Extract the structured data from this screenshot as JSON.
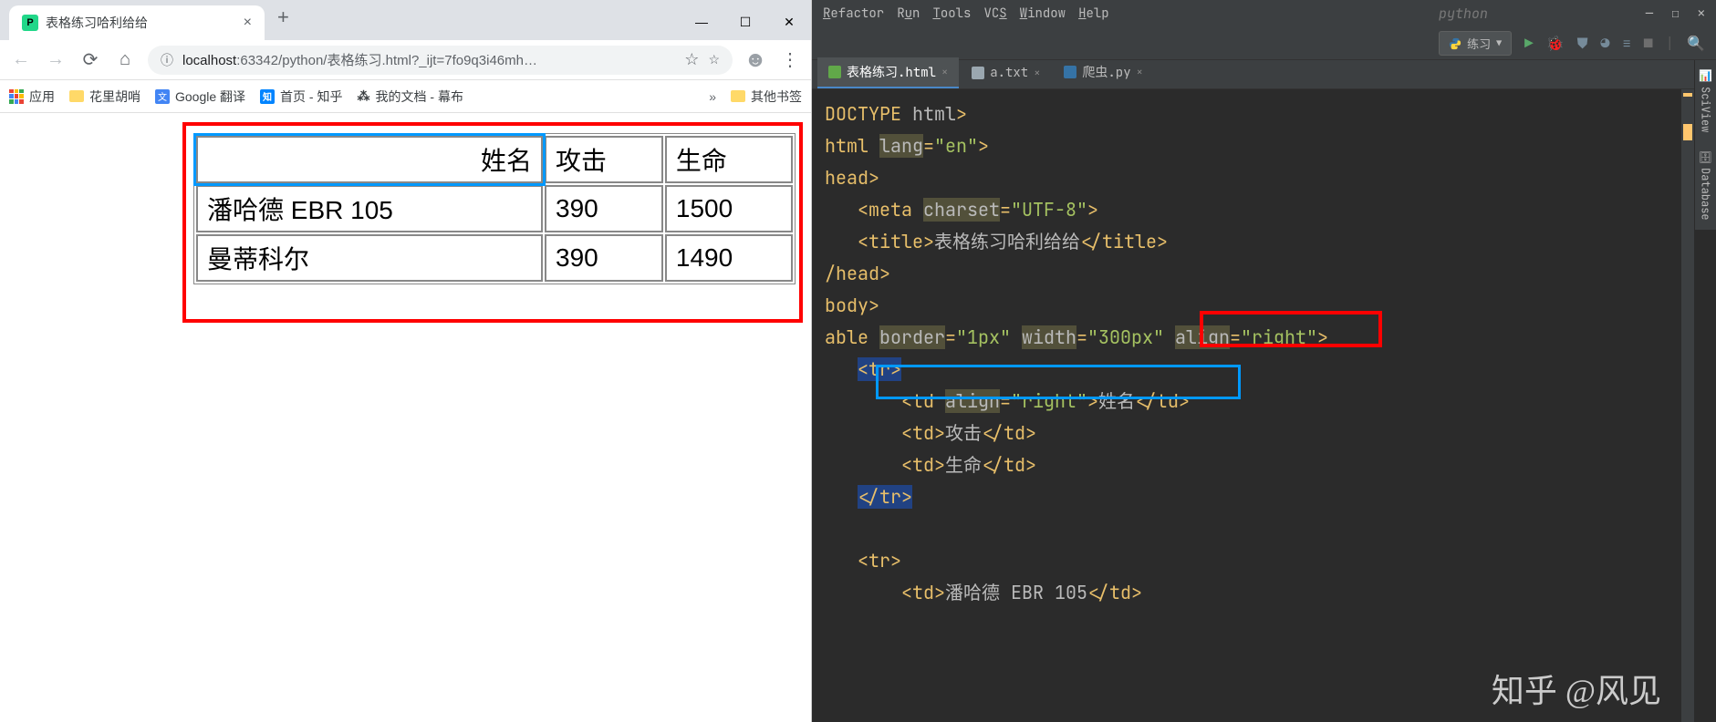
{
  "browser": {
    "tab_title": "表格练习哈利给给",
    "url_display": "localhost:63342/python/表格练习.html?_ijt=7fo9q3i46mh…",
    "bookmarks": {
      "apps": "应用",
      "items": [
        "花里胡哨",
        "Google 翻译",
        "首页 - 知乎",
        "我的文档 - 幕布"
      ],
      "other": "其他书签"
    },
    "table": {
      "headers": [
        "姓名",
        "攻击",
        "生命"
      ],
      "rows": [
        [
          "潘哈德 EBR 105",
          "390",
          "1500"
        ],
        [
          "曼蒂科尔",
          "390",
          "1490"
        ]
      ]
    }
  },
  "ide": {
    "menu": [
      "Refactor",
      "Run",
      "Tools",
      "VCS",
      "Window",
      "Help"
    ],
    "project_name": "python",
    "run_config": "练习",
    "tabs": [
      {
        "name": "表格练习.html",
        "active": true
      },
      {
        "name": "a.txt",
        "active": false
      },
      {
        "name": "爬虫.py",
        "active": false
      }
    ],
    "side_tools": [
      "SciView",
      "Database"
    ],
    "code": {
      "l1": "DOCTYPE html>",
      "l2_attr": "lang",
      "l2_val": "\"en\"",
      "l3": "head>",
      "l4_tag": "meta",
      "l4_attr": "charset",
      "l4_val": "\"UTF-8\"",
      "l5_tag": "title",
      "l5_text": "表格练习哈利给给",
      "l6": "/head>",
      "l7": "body>",
      "l8_tag": "able",
      "l8_a1": "border",
      "l8_v1": "\"1px\"",
      "l8_a2": "width",
      "l8_v2": "\"300px\"",
      "l8_a3": "align",
      "l8_v3": "\"right\"",
      "l9": "tr",
      "l10_tag": "td",
      "l10_attr": "align",
      "l10_val": "\"right\"",
      "l10_text": "姓名",
      "l11_tag": "td",
      "l11_text": "攻击",
      "l12_tag": "td",
      "l12_text": "生命",
      "l13": "tr",
      "l14": "tr",
      "l15_tag": "td",
      "l15_text": "潘哈德 EBR 105"
    }
  },
  "watermark": "知乎 @风见"
}
